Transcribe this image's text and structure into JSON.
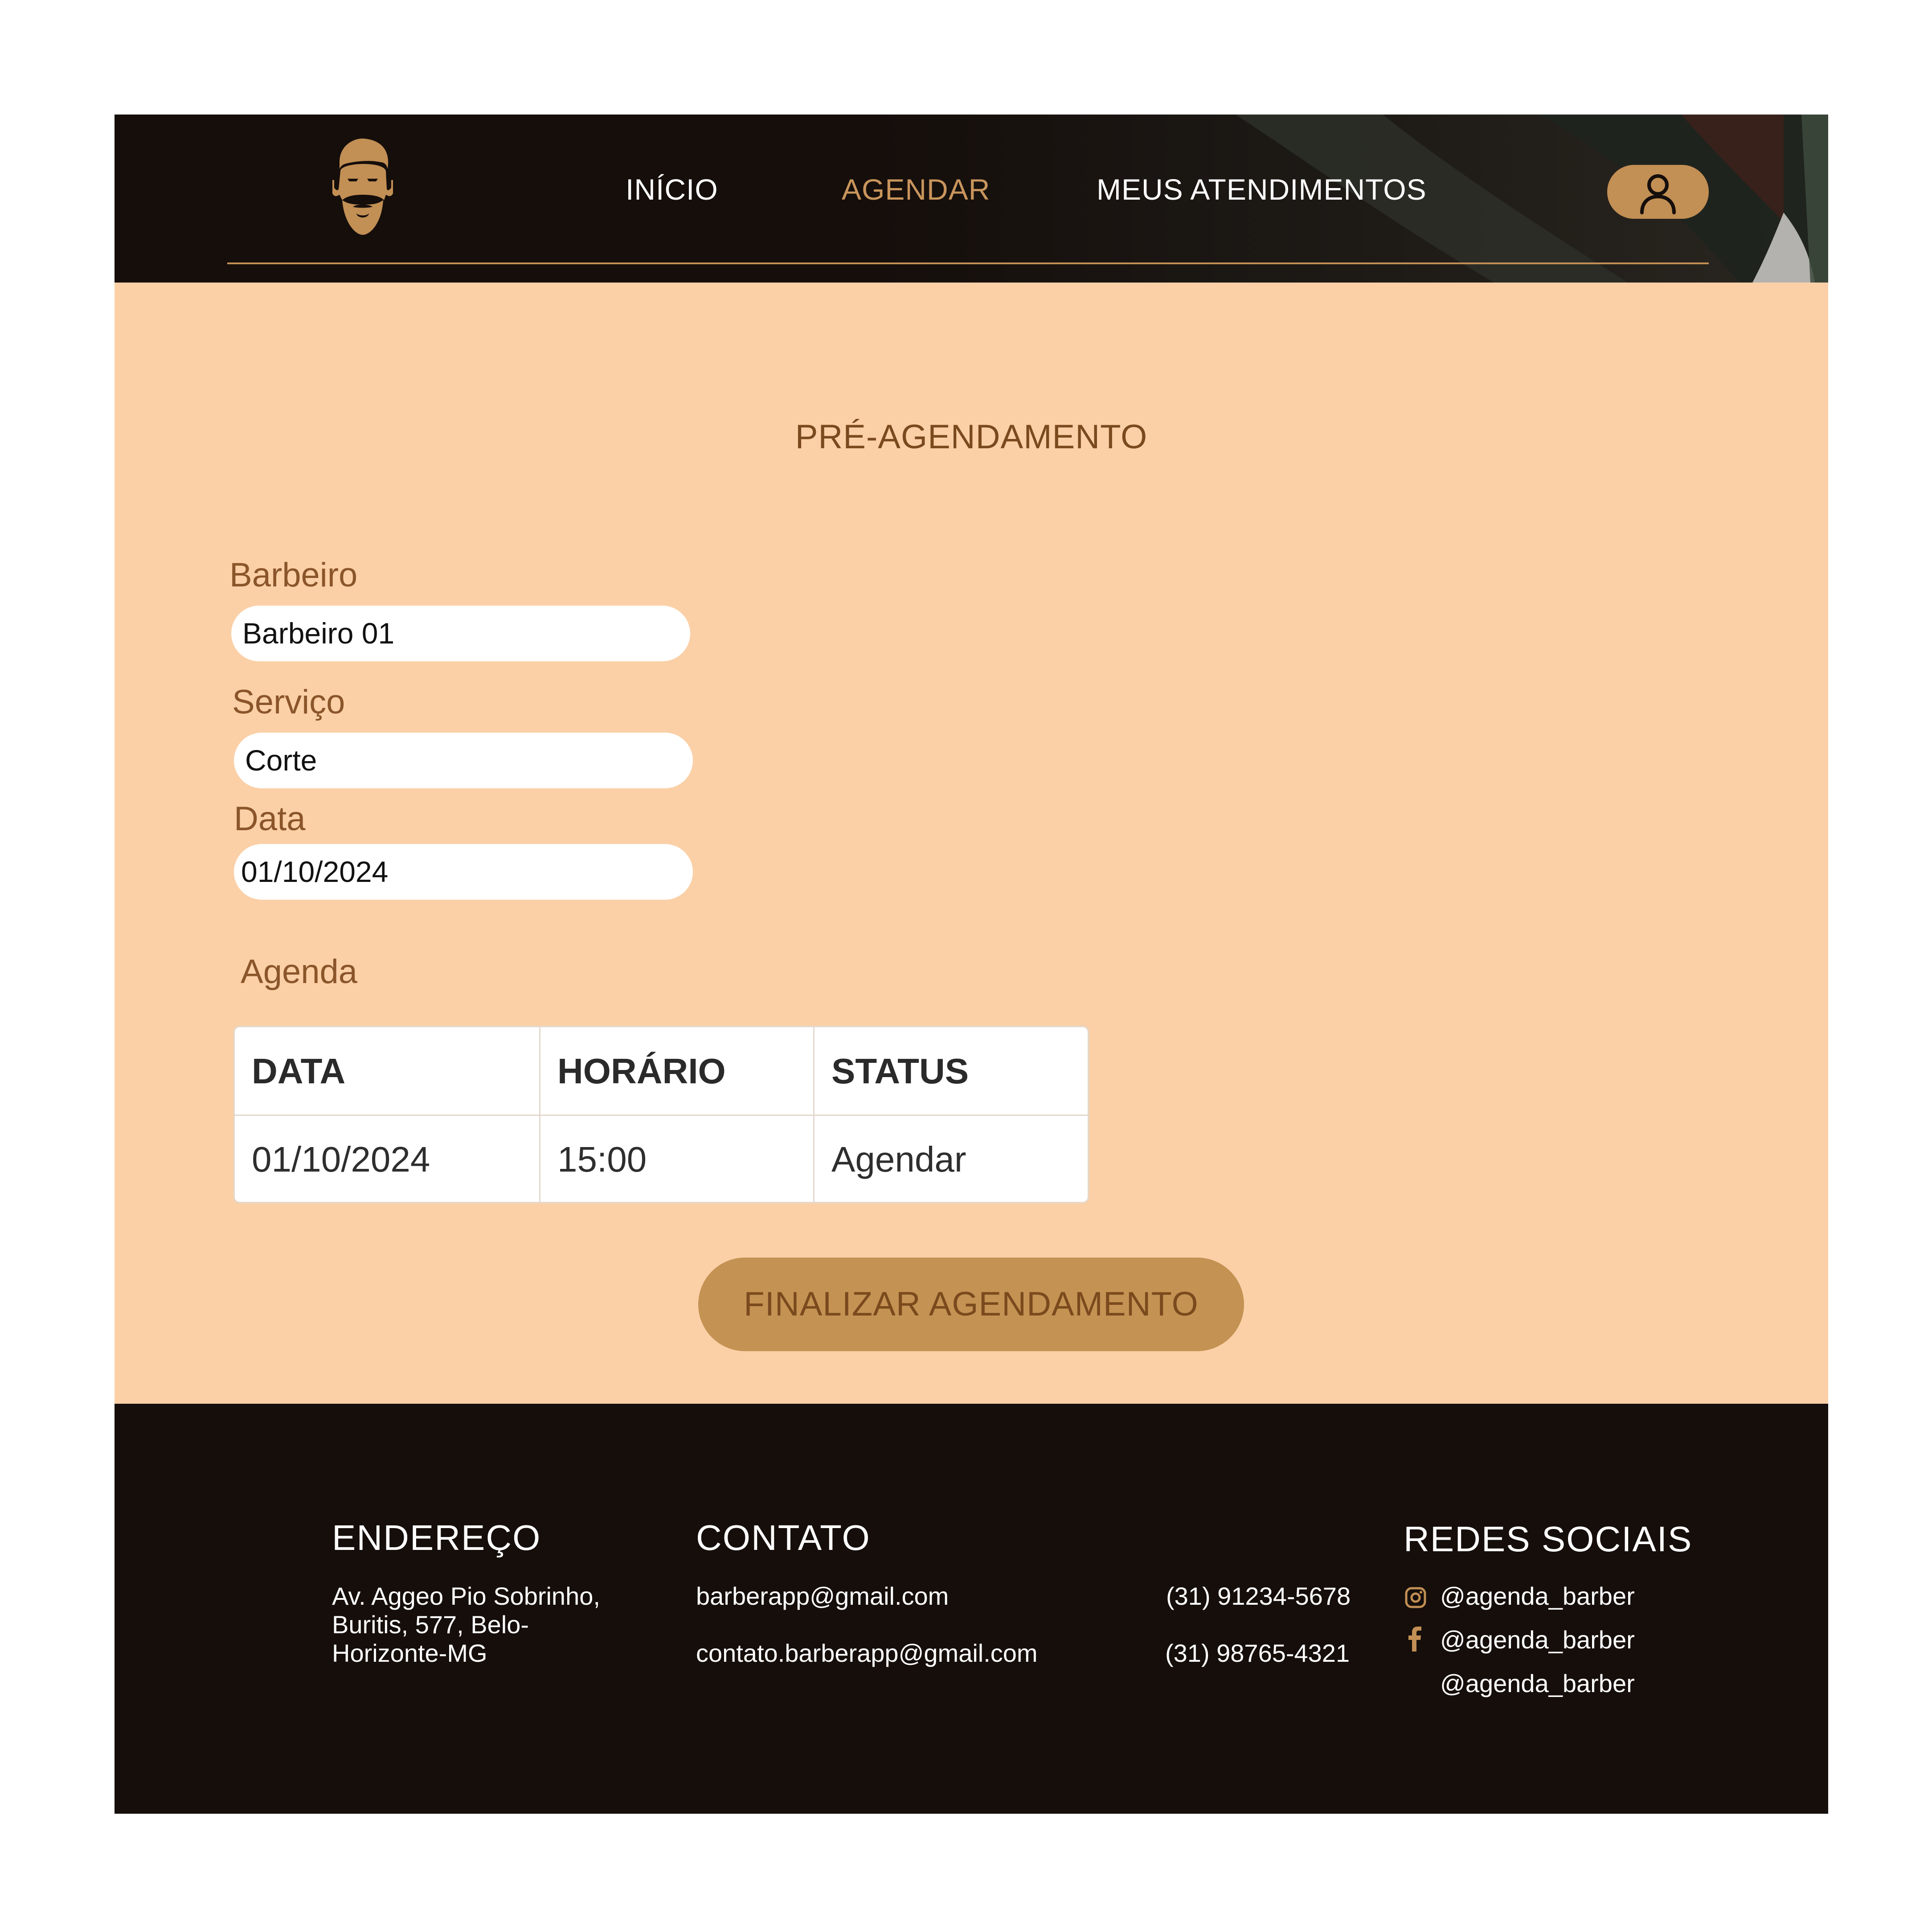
{
  "nav": {
    "items": [
      "INÍCIO",
      "AGENDAR",
      "MEUS ATENDIMENTOS"
    ],
    "active": "AGENDAR"
  },
  "page": {
    "title": "PRÉ-AGENDAMENTO"
  },
  "form": {
    "barbeiro_label": "Barbeiro",
    "barbeiro_value": "Barbeiro 01",
    "servico_label": "Serviço",
    "servico_value": "Corte",
    "data_label": "Data",
    "data_value": "01/10/2024"
  },
  "agenda": {
    "label": "Agenda",
    "columns": [
      "DATA",
      "HORÁRIO",
      "STATUS"
    ],
    "rows": [
      [
        "01/10/2024",
        "15:00",
        "Agendar"
      ]
    ]
  },
  "finalize_label": "FINALIZAR AGENDAMENTO",
  "footer": {
    "endereco_heading": "ENDEREÇO",
    "endereco_lines": [
      "Av. Aggeo Pio Sobrinho,",
      "Buritis, 577, Belo-",
      "Horizonte-MG"
    ],
    "contato_heading": "CONTATO",
    "emails": [
      "barberapp@gmail.com",
      "contato.barberapp@gmail.com"
    ],
    "phones": [
      "(31) 91234-5678",
      "(31) 98765-4321"
    ],
    "redes_heading": "REDES SOCIAIS",
    "socials": [
      {
        "icon": "instagram-icon",
        "handle": "@agenda_barber"
      },
      {
        "icon": "facebook-icon",
        "handle": "@agenda_barber"
      },
      {
        "icon": "",
        "handle": "@agenda_barber"
      }
    ]
  },
  "colors": {
    "header_bg": "#150e0b",
    "page_bg": "#fbd0a7",
    "accent": "#c28f54",
    "nav_active": "#c9955c",
    "label_brown": "#8b552a"
  }
}
